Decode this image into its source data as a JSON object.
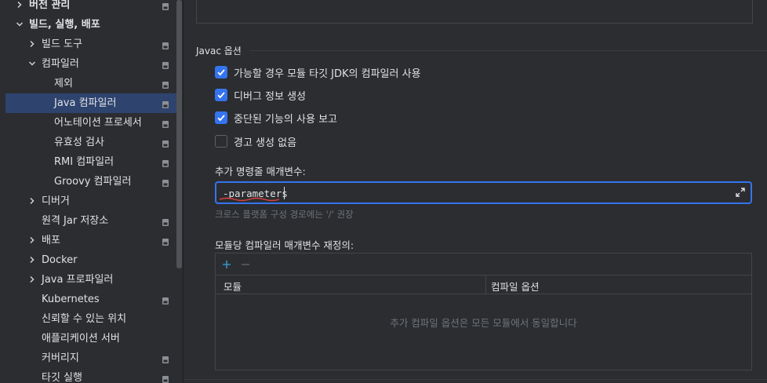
{
  "sidebar": {
    "items": [
      {
        "label": "버전 관리",
        "expandable": true,
        "expanded": false,
        "bold": true,
        "project_icon": true
      },
      {
        "label": "빌드, 실행, 배포",
        "expandable": true,
        "expanded": true,
        "bold": true,
        "project_icon": false
      },
      {
        "label": "빌드 도구",
        "expandable": true,
        "expanded": false,
        "bold": false,
        "project_icon": true
      },
      {
        "label": "컴파일러",
        "expandable": true,
        "expanded": true,
        "bold": false,
        "project_icon": true
      },
      {
        "label": "제외",
        "expandable": false,
        "bold": false,
        "project_icon": true
      },
      {
        "label": "Java 컴파일러",
        "expandable": false,
        "bold": false,
        "project_icon": true,
        "selected": true
      },
      {
        "label": "어노테이션 프로세서",
        "expandable": false,
        "bold": false,
        "project_icon": true
      },
      {
        "label": "유효성 검사",
        "expandable": false,
        "bold": false,
        "project_icon": true
      },
      {
        "label": "RMI 컴파일러",
        "expandable": false,
        "bold": false,
        "project_icon": true
      },
      {
        "label": "Groovy 컴파일러",
        "expandable": false,
        "bold": false,
        "project_icon": true
      },
      {
        "label": "디버거",
        "expandable": true,
        "expanded": false,
        "bold": false,
        "project_icon": false
      },
      {
        "label": "원격 Jar 저장소",
        "expandable": false,
        "bold": false,
        "project_icon": true
      },
      {
        "label": "배포",
        "expandable": true,
        "expanded": false,
        "bold": false,
        "project_icon": true
      },
      {
        "label": "Docker",
        "expandable": true,
        "expanded": false,
        "bold": false,
        "project_icon": false
      },
      {
        "label": "Java 프로파일러",
        "expandable": true,
        "expanded": false,
        "bold": false,
        "project_icon": false
      },
      {
        "label": "Kubernetes",
        "expandable": false,
        "bold": false,
        "project_icon": true
      },
      {
        "label": "신뢰할 수 있는 위치",
        "expandable": false,
        "bold": false,
        "project_icon": false
      },
      {
        "label": "애플리케이션 서버",
        "expandable": false,
        "bold": false,
        "project_icon": false
      },
      {
        "label": "커버리지",
        "expandable": false,
        "bold": false,
        "project_icon": true
      },
      {
        "label": "타깃 실행",
        "expandable": false,
        "bold": false,
        "project_icon": true
      }
    ]
  },
  "javac": {
    "section_title": "Javac 옵션",
    "options": [
      {
        "label": "가능할 경우 모듈 타깃 JDK의 컴파일러 사용",
        "checked": true
      },
      {
        "label": "디버그 정보 생성",
        "checked": true
      },
      {
        "label": "중단된 기능의 사용 보고",
        "checked": true
      },
      {
        "label": "경고 생성 없음",
        "checked": false
      }
    ],
    "params_label": "추가 명령줄 매개변수:",
    "params_value": "-parameters",
    "params_hint": "크로스 플랫폼 구성 경로에는 '/' 권장",
    "override_label": "모듈당 컴파일러 매개변수 재정의:",
    "table": {
      "columns": [
        "모듈",
        "컴파일 옵션"
      ],
      "empty_text": "추가 컴파일 옵션은 모든 모듈에서 동일합니다"
    }
  },
  "colors": {
    "accent": "#3574f0",
    "selection": "#2e436e",
    "background": "#2b2d30",
    "squiggle": "#e04040"
  },
  "icons": {
    "expand": "expand-arrows-icon",
    "add": "plus-icon",
    "remove": "minus-icon"
  }
}
